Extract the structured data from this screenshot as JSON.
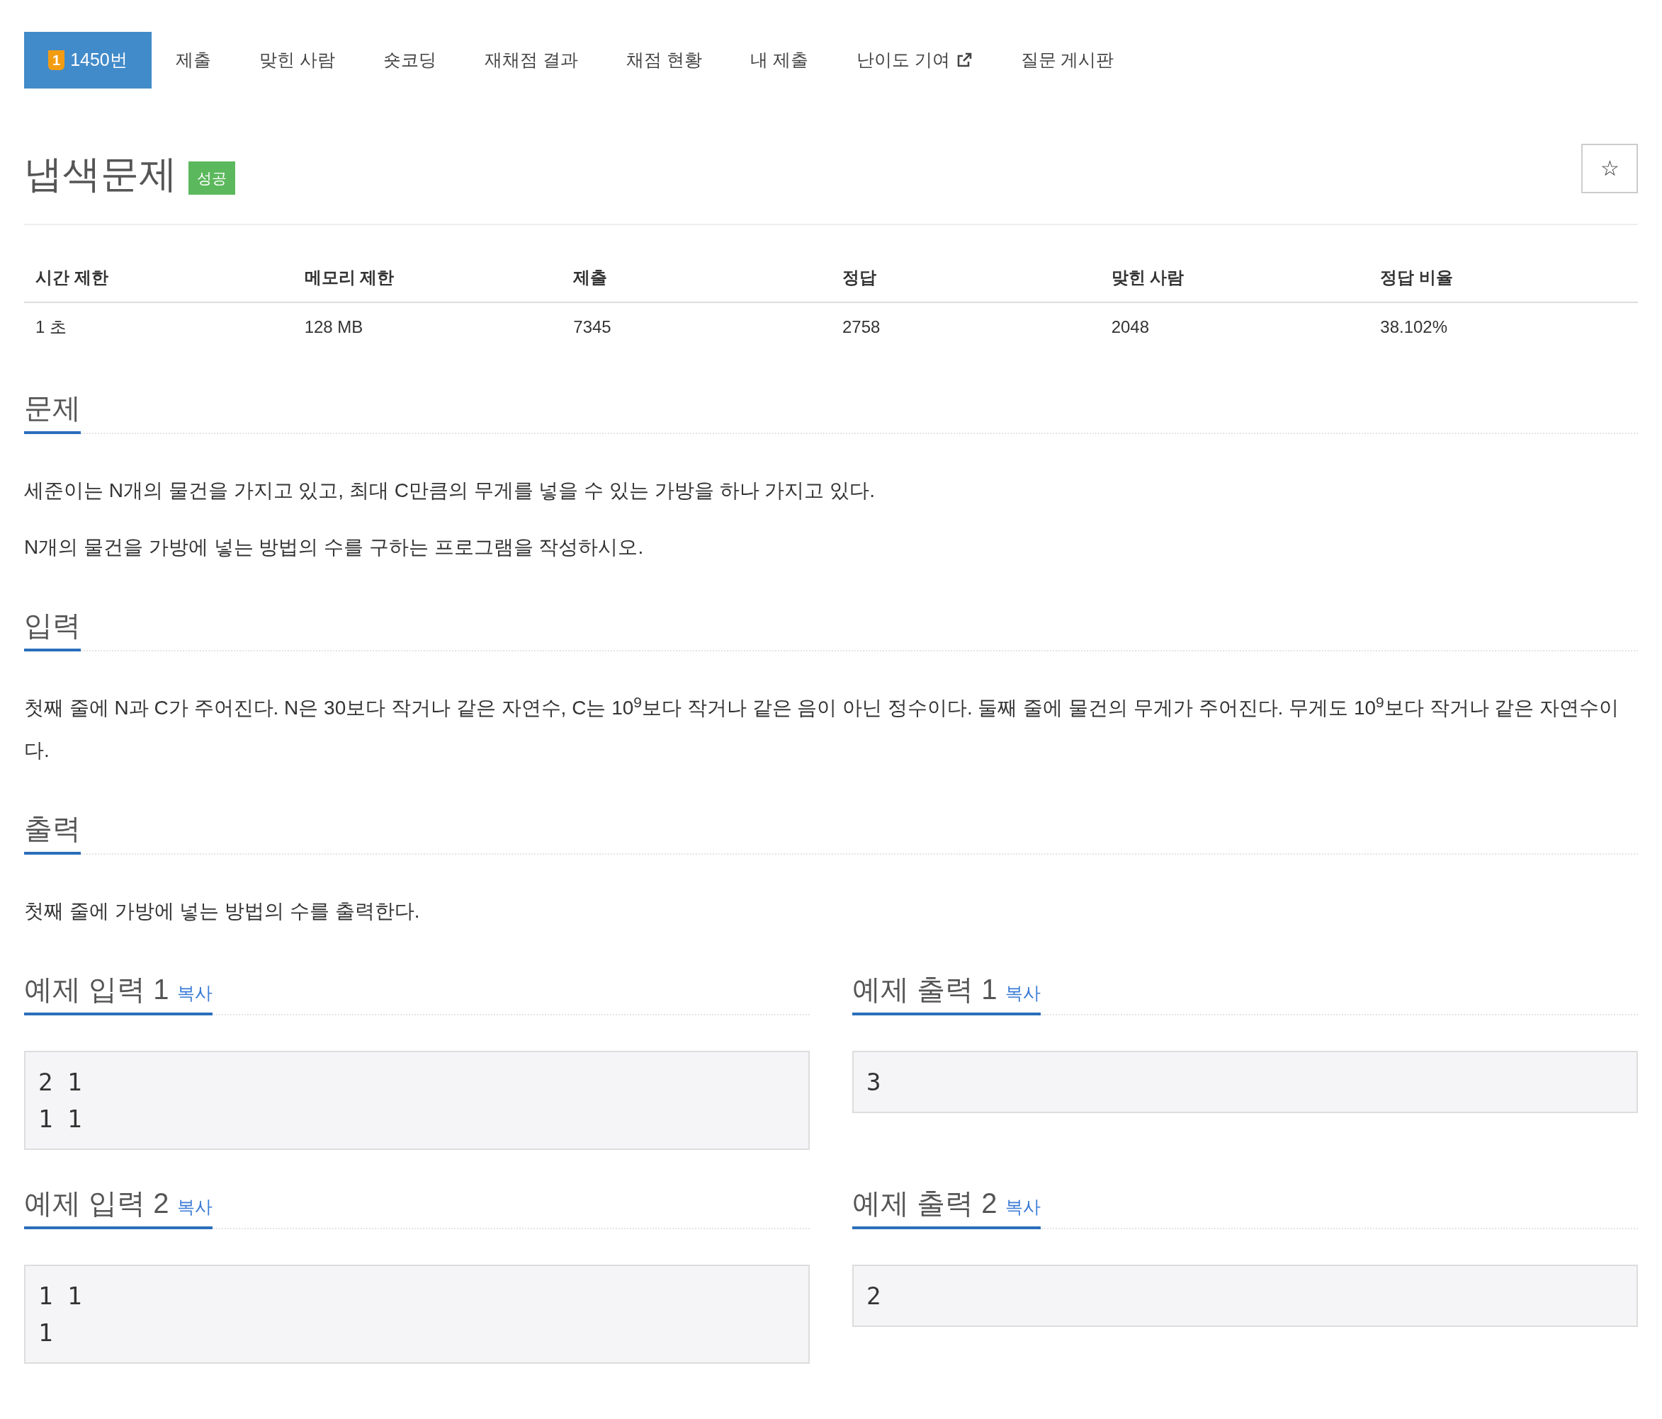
{
  "tabs": [
    {
      "label": "1450번",
      "tier": "1",
      "selected": true,
      "external": false
    },
    {
      "label": "제출",
      "selected": false,
      "external": false
    },
    {
      "label": "맞힌 사람",
      "selected": false,
      "external": false
    },
    {
      "label": "숏코딩",
      "selected": false,
      "external": false
    },
    {
      "label": "재채점 결과",
      "selected": false,
      "external": false
    },
    {
      "label": "채점 현황",
      "selected": false,
      "external": false
    },
    {
      "label": "내 제출",
      "selected": false,
      "external": false
    },
    {
      "label": "난이도 기여",
      "selected": false,
      "external": true
    },
    {
      "label": "질문 게시판",
      "selected": false,
      "external": false
    }
  ],
  "problem": {
    "title": "냅색문제",
    "status": "성공",
    "star": "☆"
  },
  "info_table": {
    "columns": [
      "시간 제한",
      "메모리 제한",
      "제출",
      "정답",
      "맞힌 사람",
      "정답 비율"
    ],
    "rows": [
      [
        "1 초",
        "128 MB",
        "7345",
        "2758",
        "2048",
        "38.102%"
      ]
    ]
  },
  "sections": [
    {
      "title": "문제",
      "paragraphs": [
        "세준이는 N개의 물건을 가지고 있고, 최대 C만큼의 무게를 넣을 수 있는 가방을 하나 가지고 있다.",
        "N개의 물건을 가방에 넣는 방법의 수를 구하는 프로그램을 작성하시오."
      ]
    },
    {
      "title": "입력",
      "paragraphs": [
        "첫째 줄에 N과 C가 주어진다. N은 30보다 작거나 같은 자연수, C는 10$^{9}$보다 작거나 같은 음이 아닌 정수이다. 둘째 줄에 물건의 무게가 주어진다. 무게도 10$^{9}$보다 작거나 같은 자연수이다."
      ]
    },
    {
      "title": "출력",
      "paragraphs": [
        "첫째 줄에 가방에 넣는 방법의 수를 출력한다."
      ]
    }
  ],
  "samples": [
    {
      "title": "예제 입력 1",
      "copy": "복사",
      "lines": [
        "2 1",
        "1 1"
      ]
    },
    {
      "title": "예제 출력 1",
      "copy": "복사",
      "lines": [
        "3"
      ]
    },
    {
      "title": "예제 입력 2",
      "copy": "복사",
      "lines": [
        "1 1",
        "1"
      ]
    },
    {
      "title": "예제 출력 2",
      "copy": "복사",
      "lines": [
        "2"
      ]
    }
  ]
}
